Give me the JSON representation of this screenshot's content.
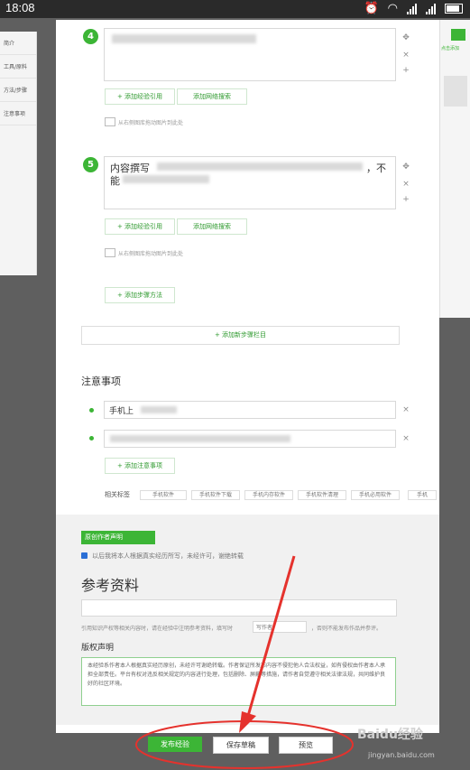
{
  "status_bar": {
    "time": "18:08"
  },
  "left_nav": {
    "items": [
      "简介",
      "工具/原料",
      "方法/步骤",
      "注意事项"
    ]
  },
  "right_panel": {
    "hint": "点击添加"
  },
  "steps": [
    {
      "number": "4",
      "content": "",
      "add_exp_label": "+ 添加经验引用",
      "add_web_label": "添加网络搜索",
      "image_hint": "从右侧图库拖动图片到此处"
    },
    {
      "number": "5",
      "content_start": "内容撰写",
      "content_end": "，不",
      "content_line2": "能",
      "add_exp_label": "+ 添加经验引用",
      "add_web_label": "添加网络搜索",
      "image_hint": "从右侧图库拖动图片到此处"
    }
  ],
  "add_method_label": "+ 添加步骤方法",
  "add_section_label": "+ 添加新步骤栏目",
  "notes": {
    "title": "注意事项",
    "items": [
      {
        "text": "手机上"
      },
      {
        "text": ""
      }
    ],
    "add_label": "+ 添加注意事项"
  },
  "related_tags": {
    "label": "相关标签",
    "tags": [
      "手机软件",
      "手机软件下载",
      "手机内存软件",
      "手机软件清理",
      "手机必用软件",
      "手机"
    ]
  },
  "original": {
    "badge": "原创作者声明",
    "checkbox_text": "以后我将本人根据真实经历所写，未经许可，谢绝转载"
  },
  "references": {
    "title": "参考资料",
    "note": "引用知识产权等相关内容时，请在经验中注明参考资料，填写时",
    "note_field": "写作者",
    "note_tail": "，否则不能发布作品并参评。"
  },
  "copyright": {
    "title": "版权声明",
    "text": "本经验系作者本人根据真实经历原创，未经许可谢绝转载。作者保证所发布内容不侵犯他人合法权益，如有侵权由作者本人承担全部责任。平台有权对违反相关规定的内容进行处理，包括删除、屏蔽等措施，请作者自觉遵守相关法律法规，共同维护良好的社区环境。"
  },
  "actions": {
    "publish": "发布经验",
    "save": "保存草稿",
    "preview": "预览"
  },
  "watermark": {
    "text": "Baidu经验",
    "url": "jingyan.baidu.com"
  },
  "colors": {
    "accent_green": "#3cb536",
    "annotation_red": "#e5322d"
  }
}
